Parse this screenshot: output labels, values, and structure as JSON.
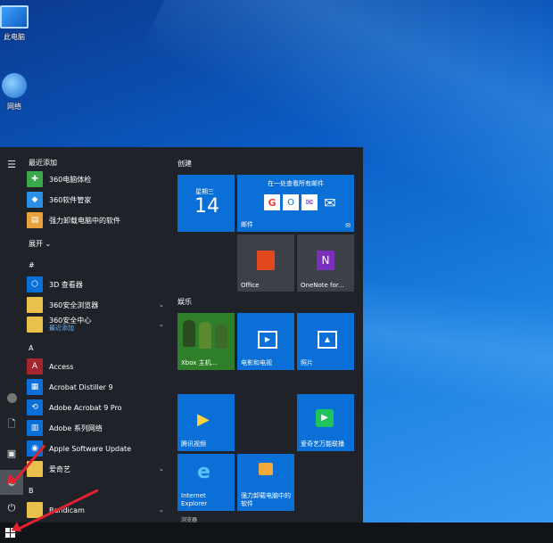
{
  "desktop": {
    "icons": [
      {
        "label": "此电脑",
        "icon": "computer-icon"
      },
      {
        "label": "网络",
        "icon": "network-icon"
      }
    ]
  },
  "start_menu": {
    "rail": {
      "icons": [
        "hamburger-icon",
        "user-icon",
        "document-icon",
        "pictures-icon",
        "settings-icon",
        "power-icon"
      ]
    },
    "app_list": {
      "recent_header": "最近添加",
      "recent": [
        "360电脑体检",
        "360软件管家",
        "强力卸载电脑中的软件"
      ],
      "expand": "展开",
      "sections": [
        {
          "letter": "#",
          "items": [
            {
              "label": "3D 查看器"
            },
            {
              "label": "360安全浏览器"
            },
            {
              "label": "360安全中心",
              "sub": "最近添加"
            }
          ]
        },
        {
          "letter": "A",
          "items": [
            {
              "label": "Access"
            },
            {
              "label": "Acrobat Distiller 9"
            },
            {
              "label": "Adobe Acrobat 9 Pro"
            },
            {
              "label": "Adobe 系列网络"
            },
            {
              "label": "Apple Software Update"
            },
            {
              "label": "爱奇艺"
            }
          ]
        },
        {
          "letter": "B",
          "items": [
            {
              "label": "Bandicam"
            }
          ]
        }
      ]
    },
    "tiles": {
      "create_header": "创建",
      "calendar": {
        "day": "星期三",
        "date": "14"
      },
      "mail": {
        "title": "在一处查看所有邮件",
        "label": "邮件"
      },
      "office": "Office",
      "onenote": "OneNote for...",
      "entertainment_header": "娱乐",
      "xbox": "Xbox 主机...",
      "movies": "电影和电视",
      "photos": "照片",
      "tencent_video": "腾讯视频",
      "iqiyi": "爱奇艺万能联播",
      "ie": "Internet Explorer",
      "uninstall": "强力卸载电脑中的软件",
      "partial_label": "浏览器"
    }
  },
  "colors": {
    "tile_blue": "#0a6fd6",
    "menu_bg": "#1f2329",
    "annotation": "#e0232e"
  }
}
